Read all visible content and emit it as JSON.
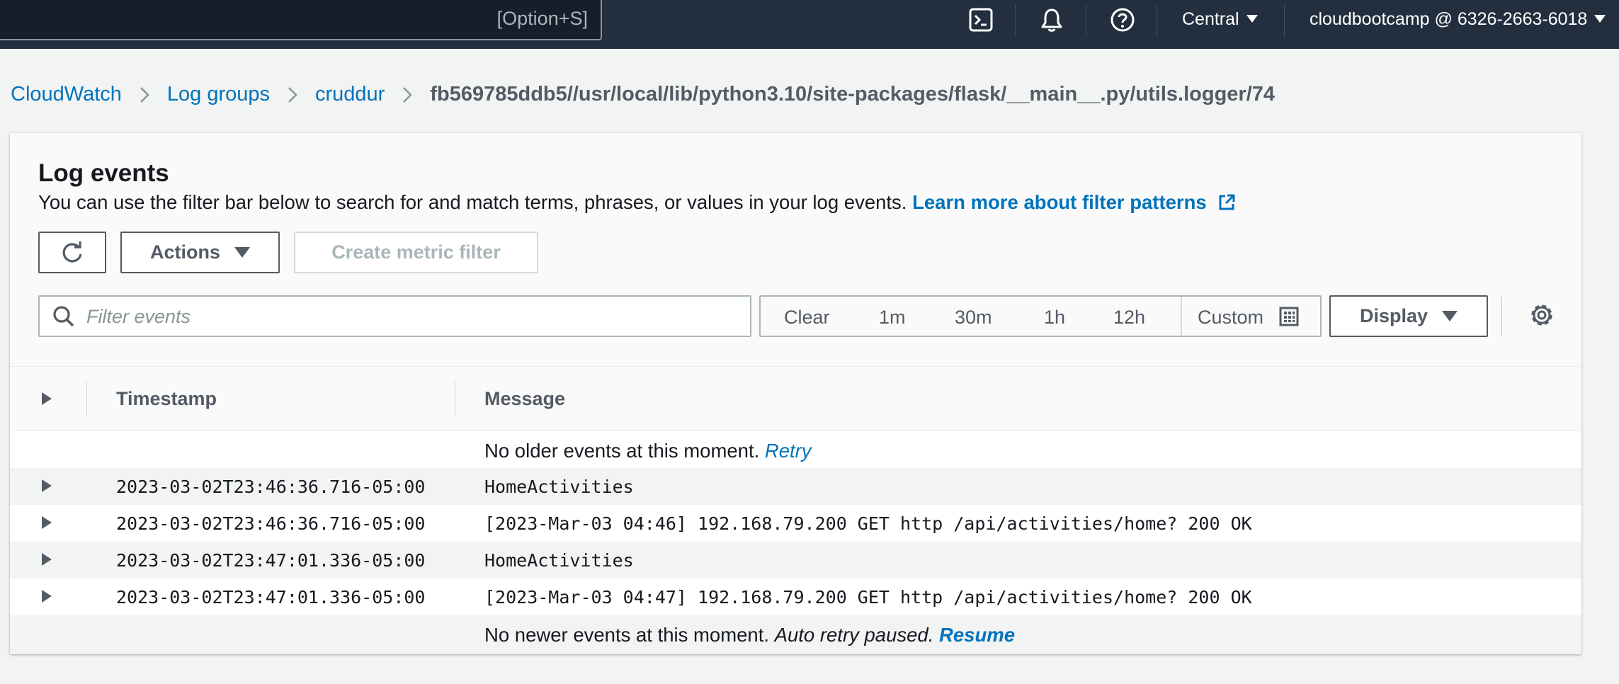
{
  "topbar": {
    "search_shortcut": "[Option+S]",
    "region": "Central",
    "account": "cloudbootcamp @ 6326-2663-6018",
    "icons": [
      "cloudshell-icon",
      "bell-icon",
      "help-icon"
    ]
  },
  "breadcrumb": {
    "items": [
      "CloudWatch",
      "Log groups",
      "cruddur"
    ],
    "current": "fb569785ddb5//usr/local/lib/python3.10/site-packages/flask/__main__.py/utils.logger/74"
  },
  "panel": {
    "title": "Log events",
    "description": "You can use the filter bar below to search for and match terms, phrases, or values in your log events. ",
    "learn_more": "Learn more about filter patterns",
    "buttons": {
      "actions": "Actions",
      "create_metric_filter": "Create metric filter",
      "display": "Display"
    },
    "filter_placeholder": "Filter events",
    "time_ranges": {
      "clear": "Clear",
      "r1": "1m",
      "r2": "30m",
      "r3": "1h",
      "r4": "12h",
      "custom": "Custom"
    }
  },
  "table": {
    "columns": {
      "timestamp": "Timestamp",
      "message": "Message"
    },
    "older": {
      "text": "No older events at this moment. ",
      "link": "Retry"
    },
    "rows": [
      {
        "timestamp": "2023-03-02T23:46:36.716-05:00",
        "message": "HomeActivities"
      },
      {
        "timestamp": "2023-03-02T23:46:36.716-05:00",
        "message": "[2023-Mar-03 04:46] 192.168.79.200 GET http /api/activities/home? 200 OK"
      },
      {
        "timestamp": "2023-03-02T23:47:01.336-05:00",
        "message": "HomeActivities"
      },
      {
        "timestamp": "2023-03-02T23:47:01.336-05:00",
        "message": "[2023-Mar-03 04:47] 192.168.79.200 GET http /api/activities/home? 200 OK"
      }
    ],
    "newer": {
      "text": "No newer events at this moment. ",
      "paused": "Auto retry paused.",
      "link": "Resume"
    }
  },
  "colors": {
    "topbar_bg": "#232f3e",
    "link": "#0073bb",
    "text": "#16191f",
    "muted": "#545b64"
  }
}
